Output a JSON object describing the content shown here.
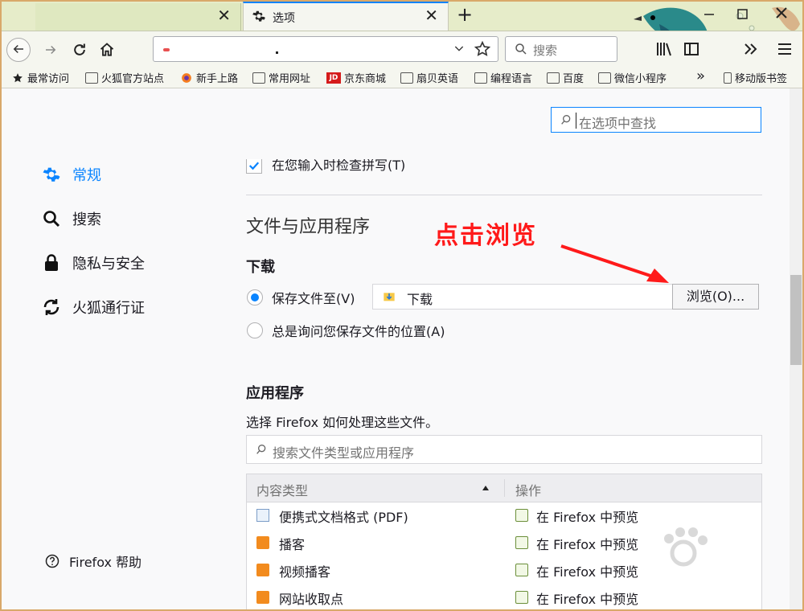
{
  "tabs": [
    {
      "title": "",
      "close": "✕"
    },
    {
      "title": "选项",
      "close": "✕"
    }
  ],
  "new_tab": "+",
  "search_bar": {
    "placeholder": "搜索"
  },
  "bookmarks": [
    "最常访问",
    "火狐官方站点",
    "新手上路",
    "常用网址",
    "京东商城",
    "扇贝英语",
    "编程语言",
    "百度",
    "微信小程序"
  ],
  "bookmarks_overflow": "»",
  "bookmarks_mobile": "移动版书签",
  "jd_badge": "JD",
  "find_box": {
    "placeholder": "在选项中查找"
  },
  "sidebar": {
    "items": [
      {
        "label": "常规",
        "icon": "gear-icon",
        "active": true
      },
      {
        "label": "搜索",
        "icon": "search-icon"
      },
      {
        "label": "隐私与安全",
        "icon": "lock-icon"
      },
      {
        "label": "火狐通行证",
        "icon": "sync-icon"
      }
    ],
    "help": "Firefox 帮助"
  },
  "spellcheck_label": "在您输入时检查拼写(T)",
  "files_section": {
    "title": "文件与应用程序",
    "downloads_title": "下载",
    "save_to_label": "保存文件至(V)",
    "download_folder": "下载",
    "browse_button": "浏览(O)...",
    "always_ask_label": "总是询问您保存文件的位置(A)"
  },
  "annotation": "点击浏览",
  "apps_section": {
    "title": "应用程序",
    "description": "选择 Firefox 如何处理这些文件。",
    "search_placeholder": "搜索文件类型或应用程序",
    "col_content_type": "内容类型",
    "col_action": "操作",
    "rows": [
      {
        "type": "便携式文档格式 (PDF)",
        "action": "在 Firefox 中预览",
        "icon": "pdf-icon"
      },
      {
        "type": "播客",
        "action": "在 Firefox 中预览",
        "icon": "rss-icon"
      },
      {
        "type": "视频播客",
        "action": "在 Firefox 中预览",
        "icon": "rss-icon"
      },
      {
        "type": "网站收取点",
        "action": "在 Firefox 中预览",
        "icon": "rss-icon"
      }
    ]
  },
  "colors": {
    "accent": "#0a84ff",
    "annotation": "#ff1a1a"
  }
}
